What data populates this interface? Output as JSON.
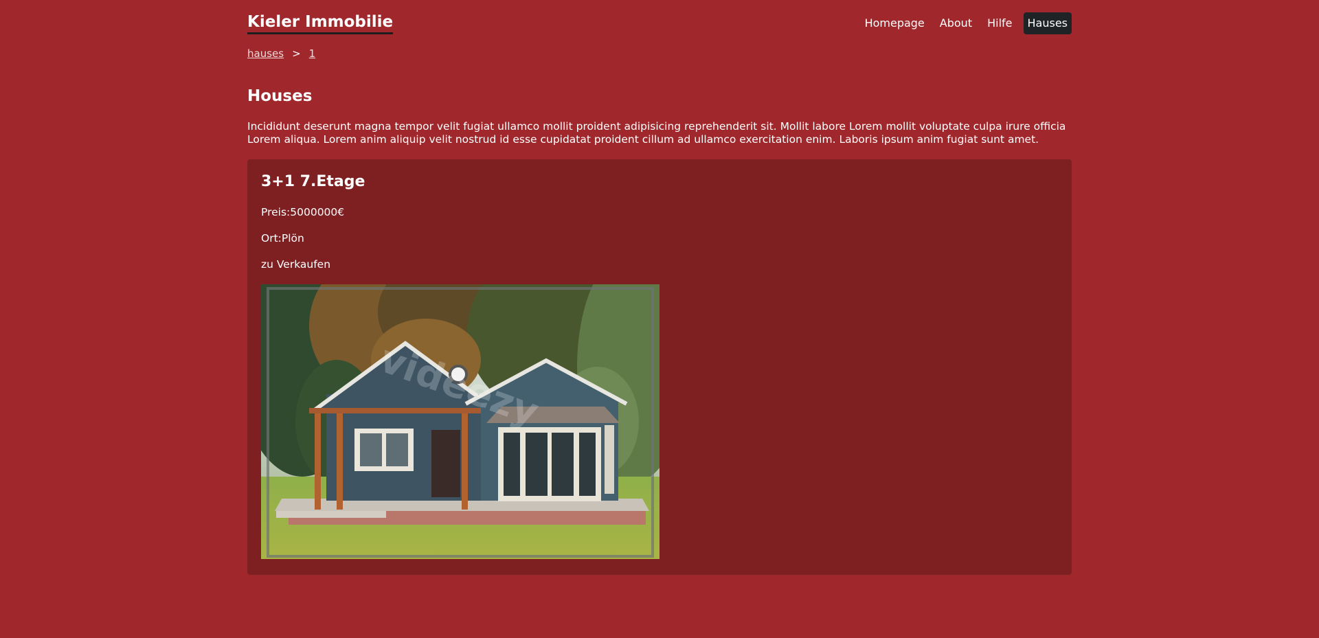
{
  "header": {
    "brand": "Kieler Immobilie",
    "nav": [
      {
        "label": "Homepage"
      },
      {
        "label": "About"
      },
      {
        "label": "Hilfe"
      },
      {
        "label": "Hauses",
        "active": true
      }
    ]
  },
  "breadcrumb": {
    "items": [
      "hauses",
      "1"
    ],
    "separator": ">"
  },
  "main": {
    "title": "Houses",
    "intro": "Incididunt deserunt magna tempor velit fugiat ullamco mollit proident adipisicing reprehenderit sit. Mollit labore Lorem mollit voluptate culpa irure officia Lorem aliqua. Lorem anim aliquip velit nostrud id esse cupidatat proident cillum ad ullamco exercitation enim. Laboris ipsum anim fugiat sunt amet."
  },
  "listing": {
    "title": "3+1 7.Etage",
    "price": "Preis:5000000€",
    "location": "Ort:Plön",
    "status": "zu Verkaufen",
    "image_watermark": "videezy"
  },
  "colors": {
    "page_background": "#a0272b",
    "card_background": "#7e2022",
    "active_nav": "#1f2326"
  }
}
